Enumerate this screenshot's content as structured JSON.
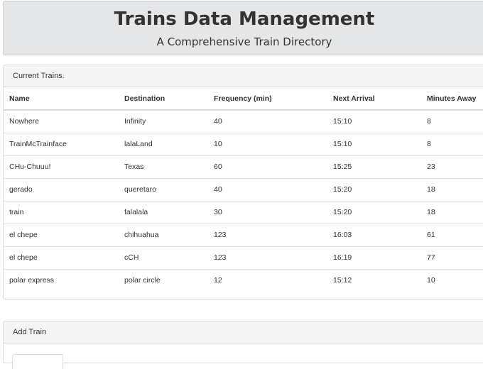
{
  "header": {
    "title": "Trains Data Management",
    "subtitle": "A Comprehensive Train Directory"
  },
  "trains_panel": {
    "heading": "Current Trains.",
    "columns": [
      "Name",
      "Destination",
      "Frequency (min)",
      "Next Arrival",
      "Minutes Away"
    ],
    "rows": [
      [
        "Nowhere",
        "Infinity",
        "40",
        "15:10",
        "8"
      ],
      [
        "TrainMcTrainface",
        "lalaLand",
        "10",
        "15:10",
        "8"
      ],
      [
        "CHu-Chuuu!",
        "Texas",
        "60",
        "15:25",
        "23"
      ],
      [
        "gerado",
        "queretaro",
        "40",
        "15:20",
        "18"
      ],
      [
        "train",
        "falalala",
        "30",
        "15:20",
        "18"
      ],
      [
        "el chepe",
        "chihuahua",
        "123",
        "16:03",
        "61"
      ],
      [
        "el chepe",
        "cCH",
        "123",
        "16:19",
        "77"
      ],
      [
        "polar express",
        "polar circle",
        "12",
        "15:12",
        "10"
      ]
    ]
  },
  "add_panel": {
    "heading": "Add Train"
  }
}
